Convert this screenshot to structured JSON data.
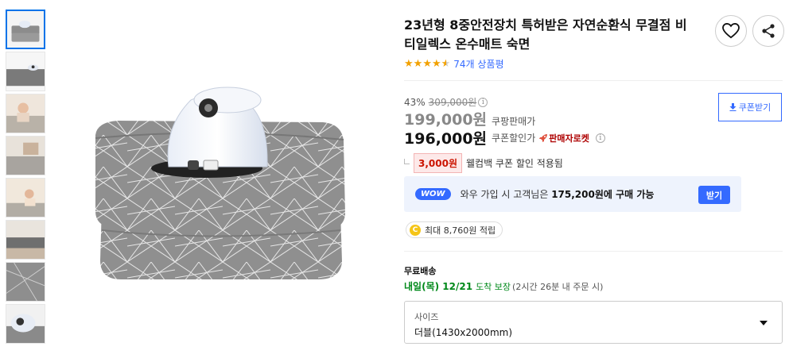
{
  "gallery": {
    "thumbnails": [
      {
        "name": "thumb-1",
        "active": true
      },
      {
        "name": "thumb-2",
        "active": false
      },
      {
        "name": "thumb-3",
        "active": false
      },
      {
        "name": "thumb-4",
        "active": false
      },
      {
        "name": "thumb-5",
        "active": false
      },
      {
        "name": "thumb-6",
        "active": false
      },
      {
        "name": "thumb-7",
        "active": false
      },
      {
        "name": "thumb-8",
        "active": false
      }
    ]
  },
  "product": {
    "title": "23년형 8중안전장치 특허받은 자연순환식 무결점 비티일렉스 온수매트 숙면",
    "rating": 4.5,
    "review_count": "74개 상품평"
  },
  "icons": {
    "heart": "heart-icon",
    "share": "share-icon",
    "download": "download-icon",
    "info": "info-icon",
    "rocket": "rocket-icon",
    "cash": "cash-icon",
    "caret": "chevron-down-icon"
  },
  "pricing": {
    "discount_rate": "43%",
    "original_price": "309,000원",
    "sale_price": "199,000원",
    "sale_label": "쿠팡판매가",
    "coupon_price": "196,000원",
    "coupon_label": "쿠폰할인가",
    "rocket_label": "판매자로켓",
    "coupon_button": "쿠폰받기",
    "welcome_amount": "3,000원",
    "welcome_text": "웰컴백 쿠폰 할인 적용됨"
  },
  "wow": {
    "badge": "WOW",
    "text_prefix": "와우 가입 시 고객님은 ",
    "text_price": "175,200원",
    "text_suffix": "에 구매 가능",
    "button": "받기"
  },
  "cash": {
    "icon_letter": "C",
    "text": "최대 8,760원 적립"
  },
  "shipping": {
    "label": "무료배송",
    "date": "내일(목) 12/21",
    "guarantee": "도착 보장",
    "note": "(2시간 26분 내 주문 시)"
  },
  "option": {
    "label": "사이즈",
    "value": "더블(1430x2000mm)"
  },
  "colors": {
    "accent_blue": "#346aff",
    "rocket_red": "#ae0000",
    "delivery_green": "#00891a",
    "star": "#f2a100"
  }
}
